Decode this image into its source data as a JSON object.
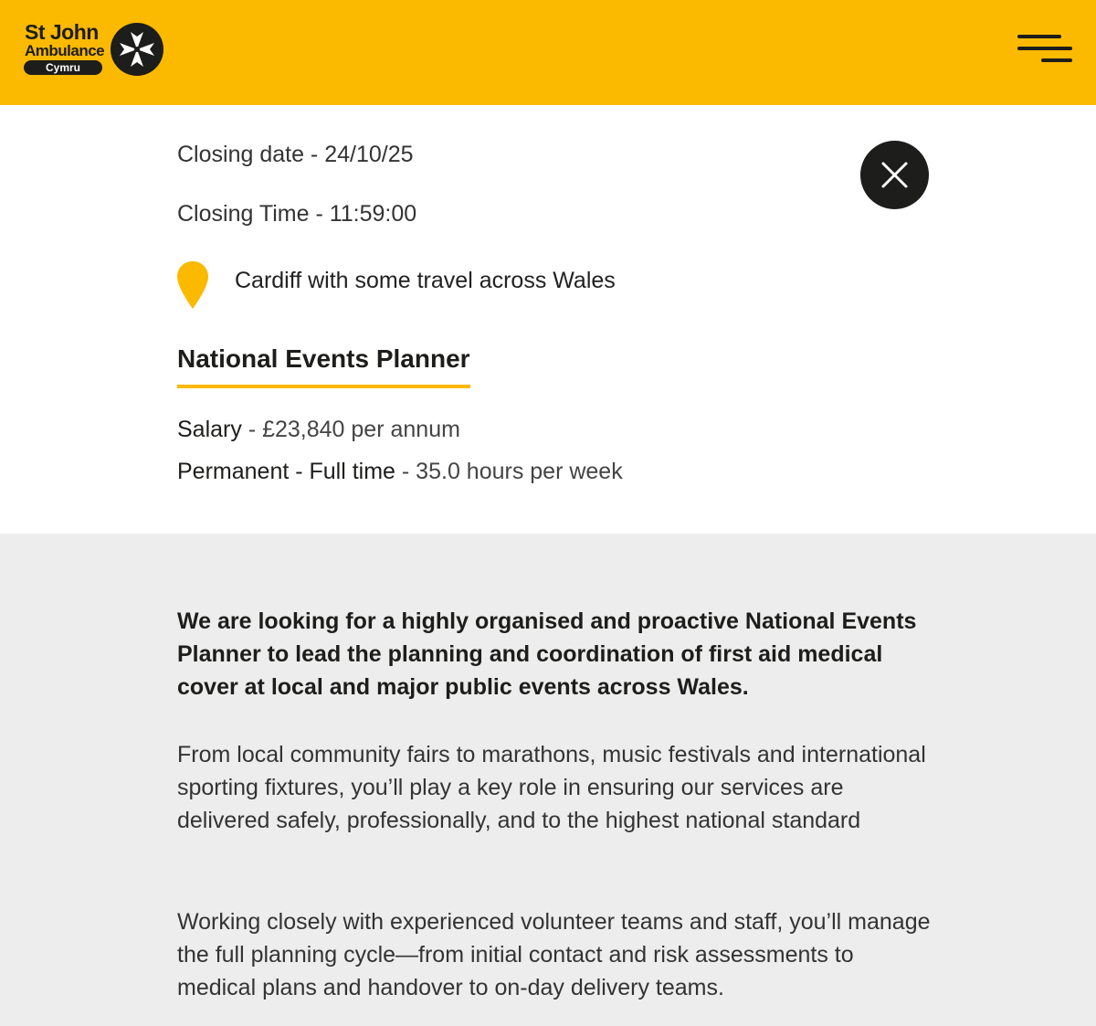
{
  "header": {
    "logo": {
      "line1": "St John",
      "line2": "Ambulance",
      "region": "Cymru",
      "badge_icon": "maltese-cross-icon"
    },
    "menu_icon": "menu-icon"
  },
  "job": {
    "closing_date": "Closing date - 24/10/25",
    "closing_time": "Closing Time - 11:59:00",
    "location_icon": "map-pin-icon",
    "location": "Cardiff with some travel across Wales",
    "title": "National Events Planner",
    "salary_label": "Salary",
    "salary_value": " - £23,840 per annum",
    "contract_label": "Permanent - Full time",
    "contract_value": " - 35.0 hours per week",
    "close_icon": "close-icon"
  },
  "description": {
    "intro": "We are looking for a highly organised and proactive National Events Planner to lead the planning and coordination of first aid medical cover at local and major public events across Wales.",
    "paragraph_1": "From local community fairs to marathons, music festivals and international sporting fixtures, you’ll play a key role in ensuring our services are delivered safely, professionally, and to the highest national standard",
    "paragraph_2": "Working closely with experienced volunteer teams and staff, you’ll manage the full planning cycle—from initial contact and risk assessments to medical plans and handover to on-day delivery teams."
  },
  "colors": {
    "brand_yellow": "#fbb900",
    "dark": "#1d1d1b",
    "section_grey": "#ededed"
  }
}
